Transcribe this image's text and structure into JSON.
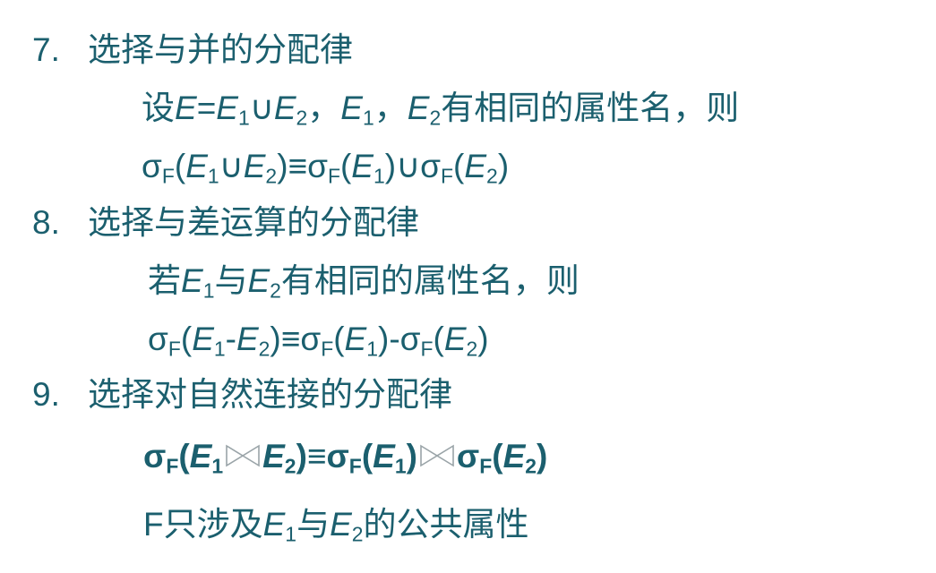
{
  "items": [
    {
      "number": "7.",
      "title": "选择与并的分配律",
      "condition": {
        "pre": "设",
        "e": "E",
        "eq": "=",
        "e1": "E",
        "sub1": "1",
        "cup": "∪",
        "e2": "E",
        "sub2": "2",
        "comma1": "，",
        "e1b": "E",
        "sub1b": "1",
        "comma2": "，",
        "e2b": "E",
        "sub2b": "2",
        "post": "有相同的属性名，则"
      },
      "formula": "σF(E1∪E2)≡σF(E1)∪σF(E2)"
    },
    {
      "number": "8.",
      "title": "选择与差运算的分配律",
      "condition": "若E1与E2有相同的属性名，则",
      "formula": "σF(E1-E2)≡σF(E1)-σF(E2)"
    },
    {
      "number": "9.",
      "title": "选择对自然连接的分配律",
      "formula": "σF(E1⋈E2)≡σF(E1)⋈σF(E2)",
      "note": "F只涉及E1与E2的公共属性"
    }
  ],
  "symbols": {
    "sigma": "σ",
    "F": "F",
    "E": "E",
    "one": "1",
    "two": "2",
    "cup": "∪",
    "equiv": "≡",
    "minus": "-",
    "lp": "(",
    "rp": ")",
    "ruo": "若",
    "yu": "与",
    "same_attr": "有相同的属性名，则",
    "note_pre": "F只涉及",
    "note_post": "的公共属性"
  },
  "icons": [
    "natural-join-icon"
  ],
  "colors": {
    "text": "#1b5f6e",
    "join_icon": "#9aa4a8"
  }
}
